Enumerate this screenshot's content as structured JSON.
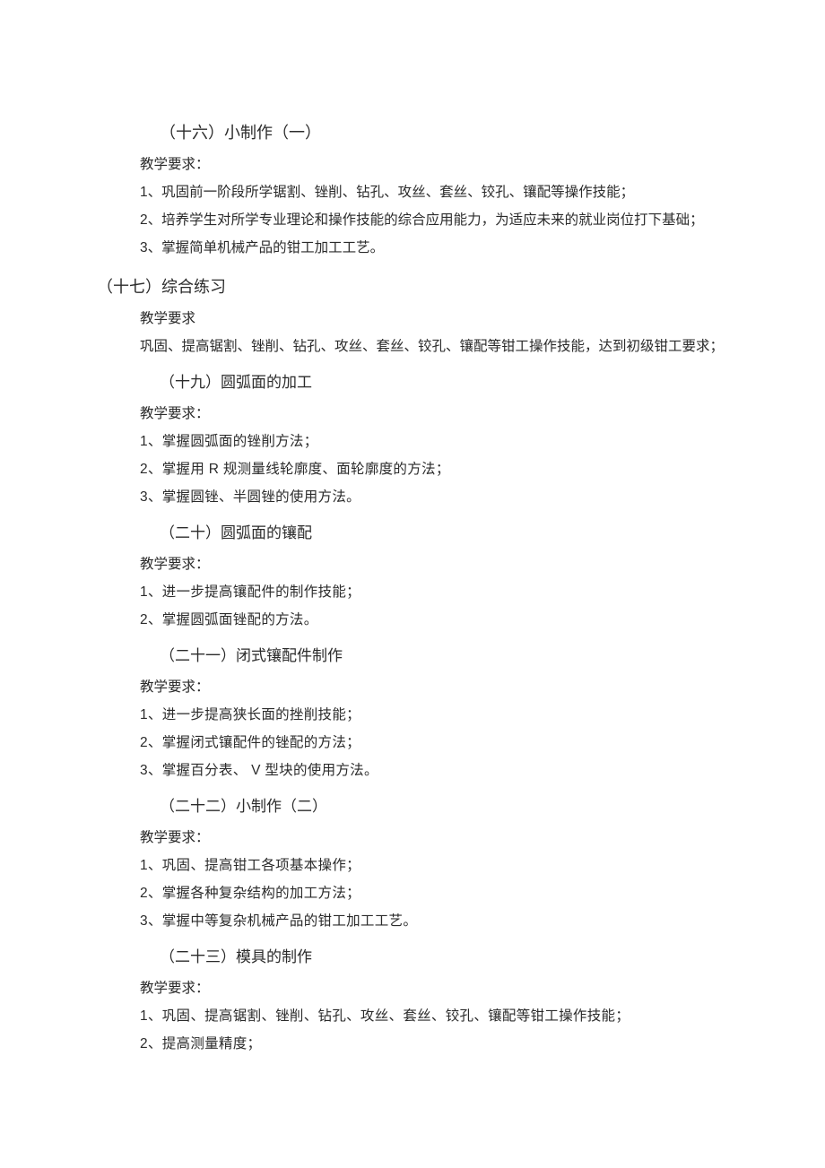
{
  "s16": {
    "title": "（十六）小制作（一）",
    "reqLabel": "教学要求：",
    "items": [
      "1、巩固前一阶段所学锯割、锉削、钻孔、攻丝、套丝、铰孔、镶配等操作技能；",
      "2、培养学生对所学专业理论和操作技能的综合应用能力，为适应未来的就业岗位打下基础；",
      "3、掌握简单机械产品的钳工加工工艺。"
    ]
  },
  "s17": {
    "title": "（十七）综合练习",
    "reqLabel": "教学要求",
    "body": "巩固、提高锯割、锉削、钻孔、攻丝、套丝、铰孔、镶配等钳工操作技能，达到初级钳工要求；"
  },
  "s19": {
    "title": "（十九）圆弧面的加工",
    "reqLabel": "教学要求：",
    "items": [
      "1、掌握圆弧面的锉削方法；",
      "2、掌握用   R 规测量线轮廓度、面轮廓度的方法；",
      "3、掌握圆锉、半圆锉的使用方法。"
    ]
  },
  "s20": {
    "title": "（二十）圆弧面的镶配",
    "reqLabel": "教学要求：",
    "items": [
      "1、进一步提高镶配件的制作技能；",
      "2、掌握圆弧面锉配的方法。"
    ]
  },
  "s21": {
    "title": "（二十一）闭式镶配件制作",
    "reqLabel": "教学要求：",
    "items": [
      "1、进一步提高狭长面的挫削技能；",
      "2、掌握闭式镶配件的锉配的方法；",
      "3、掌握百分表、   V 型块的使用方法。"
    ]
  },
  "s22": {
    "title": "（二十二）小制作（二）",
    "reqLabel": "教学要求：",
    "items": [
      "1、巩固、提高钳工各项基本操作；",
      "2、掌握各种复杂结构的加工方法；",
      "3、掌握中等复杂机械产品的钳工加工工艺。"
    ]
  },
  "s23": {
    "title": "（二十三）模具的制作",
    "reqLabel": "教学要求：",
    "items": [
      "1、巩固、提高锯割、锉削、钻孔、攻丝、套丝、铰孔、镶配等钳工操作技能；",
      "2、提高测量精度；"
    ]
  }
}
